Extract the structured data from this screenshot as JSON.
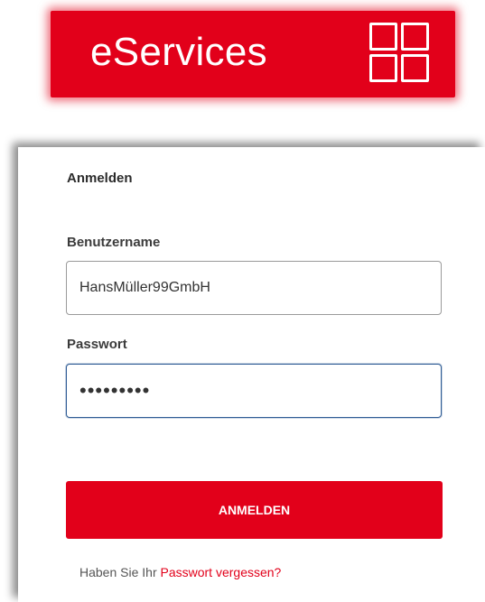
{
  "banner": {
    "title": "eServices",
    "logo_icon": "grid-icon",
    "brand_color": "#e2001a"
  },
  "login": {
    "heading": "Anmelden",
    "username": {
      "label": "Benutzername",
      "value": "HansMüller99GmbH"
    },
    "password": {
      "label": "Passwort",
      "masked_value": "•••••••••"
    },
    "submit_label": "ANMELDEN",
    "forgot_prefix": "Haben Sie Ihr",
    "forgot_link": "Passwort vergessen?"
  }
}
